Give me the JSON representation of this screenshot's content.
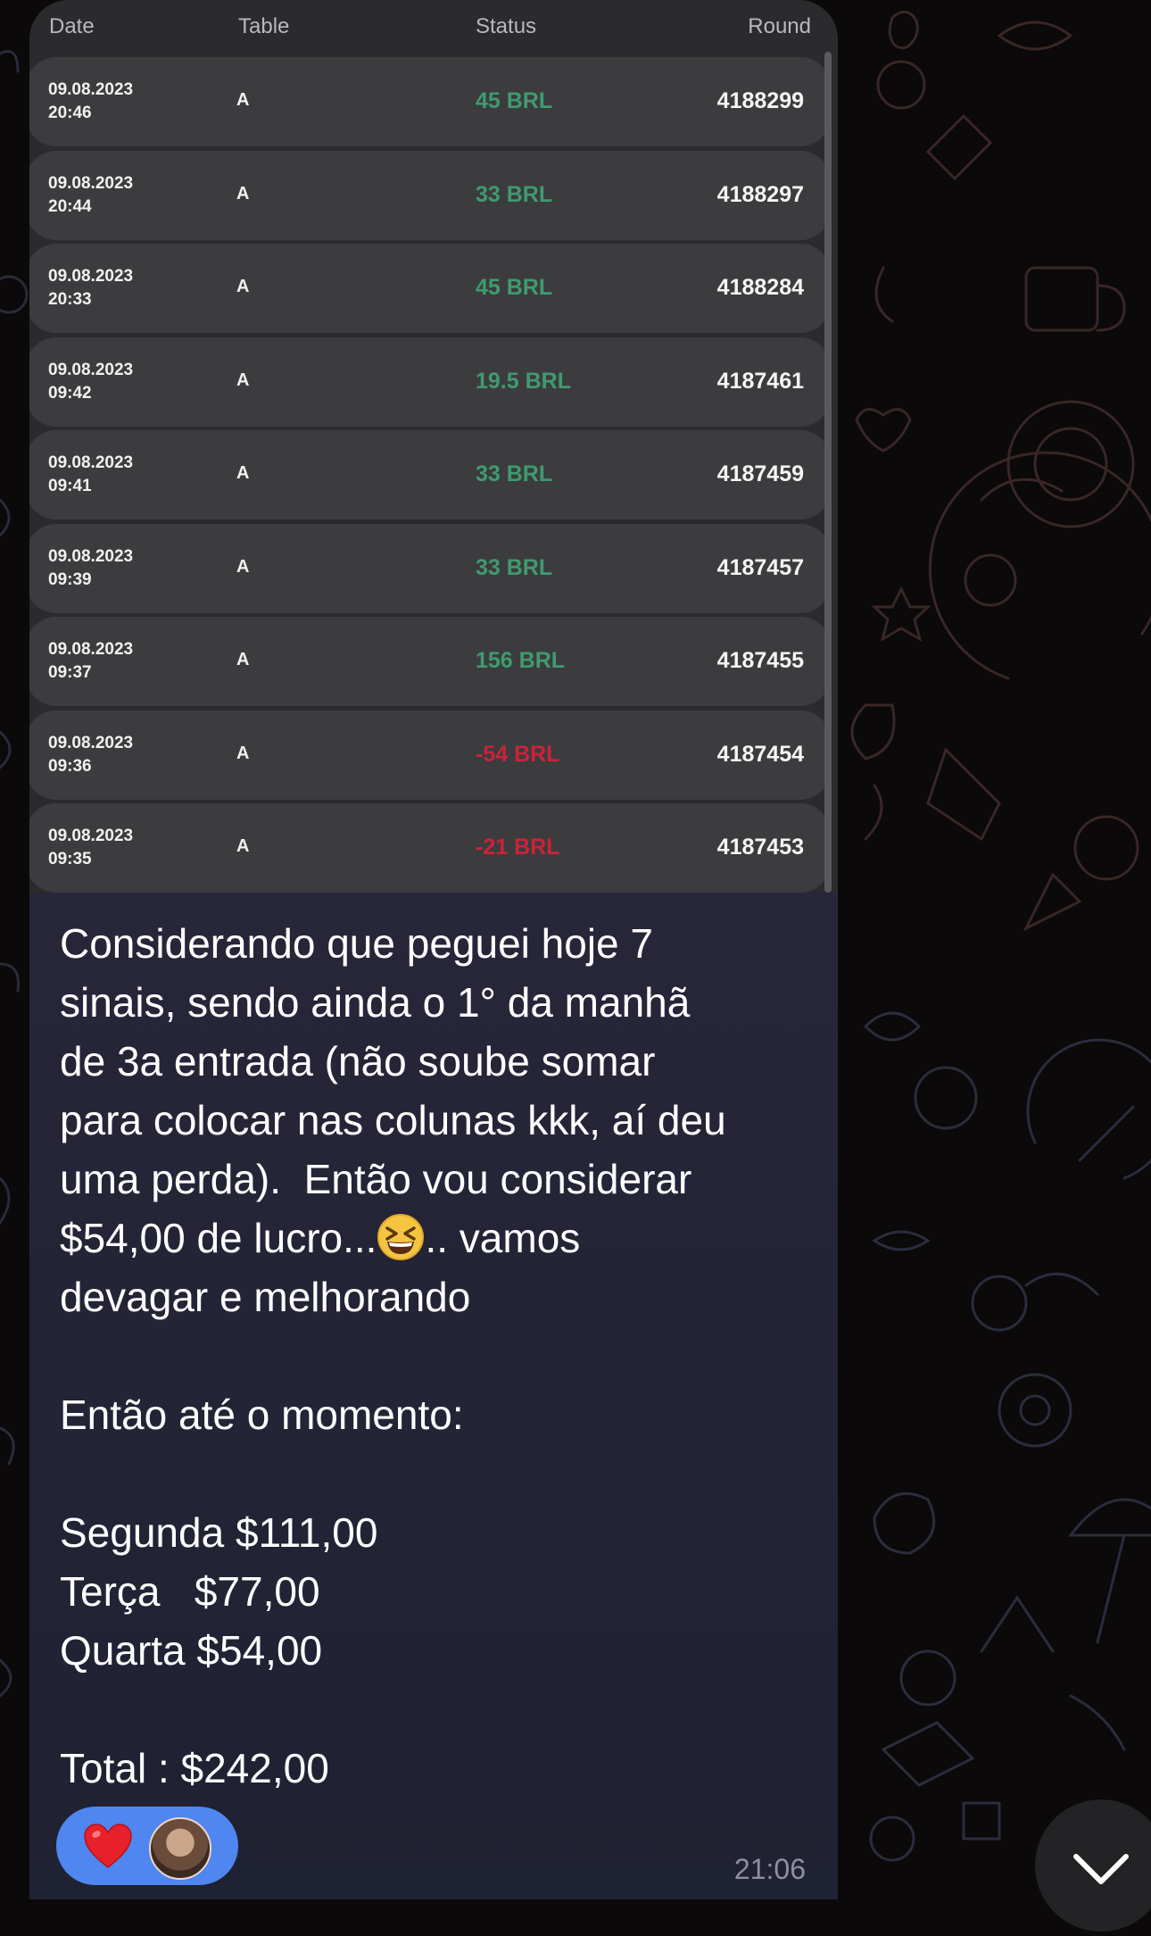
{
  "table": {
    "columns": [
      "Date",
      "Table",
      "Status",
      "Round"
    ],
    "rows": [
      {
        "date": "09.08.2023",
        "time": "20:46",
        "table": "A",
        "status": "45 BRL",
        "round": "4188299",
        "tone": "win"
      },
      {
        "date": "09.08.2023",
        "time": "20:44",
        "table": "A",
        "status": "33 BRL",
        "round": "4188297",
        "tone": "win"
      },
      {
        "date": "09.08.2023",
        "time": "20:33",
        "table": "A",
        "status": "45 BRL",
        "round": "4188284",
        "tone": "win"
      },
      {
        "date": "09.08.2023",
        "time": "09:42",
        "table": "A",
        "status": "19.5 BRL",
        "round": "4187461",
        "tone": "win"
      },
      {
        "date": "09.08.2023",
        "time": "09:41",
        "table": "A",
        "status": "33 BRL",
        "round": "4187459",
        "tone": "win"
      },
      {
        "date": "09.08.2023",
        "time": "09:39",
        "table": "A",
        "status": "33 BRL",
        "round": "4187457",
        "tone": "win"
      },
      {
        "date": "09.08.2023",
        "time": "09:37",
        "table": "A",
        "status": "156 BRL",
        "round": "4187455",
        "tone": "win"
      },
      {
        "date": "09.08.2023",
        "time": "09:36",
        "table": "A",
        "status": "-54 BRL",
        "round": "4187454",
        "tone": "loss"
      },
      {
        "date": "09.08.2023",
        "time": "09:35",
        "table": "A",
        "status": "-21 BRL",
        "round": "4187453",
        "tone": "loss"
      }
    ]
  },
  "message": {
    "part1": "Considerando que peguei hoje 7\nsinais, sendo ainda o 1° da manhã\nde 3a entrada (não soube somar\npara colocar nas colunas kkk, aí deu\numa perda).  Então vou considerar\n$54,00 de lucro...",
    "emoji": "grinning-squinting-face",
    "part2": ".. vamos\ndevagar e melhorando\n\nEntão até o momento:\n\nSegunda $111,00\nTerça   $77,00\nQuarta $54,00\n\nTotal : $242,00",
    "time": "21:06"
  },
  "reactions": {
    "emoji": "red-heart",
    "reactor": "avatar"
  },
  "colors": {
    "win": "#3f9b6f",
    "loss": "#c8243a",
    "reaction_bg": "#4f86f0",
    "bubble_top": "#2b2430",
    "bubble_bottom": "#1f2232"
  }
}
